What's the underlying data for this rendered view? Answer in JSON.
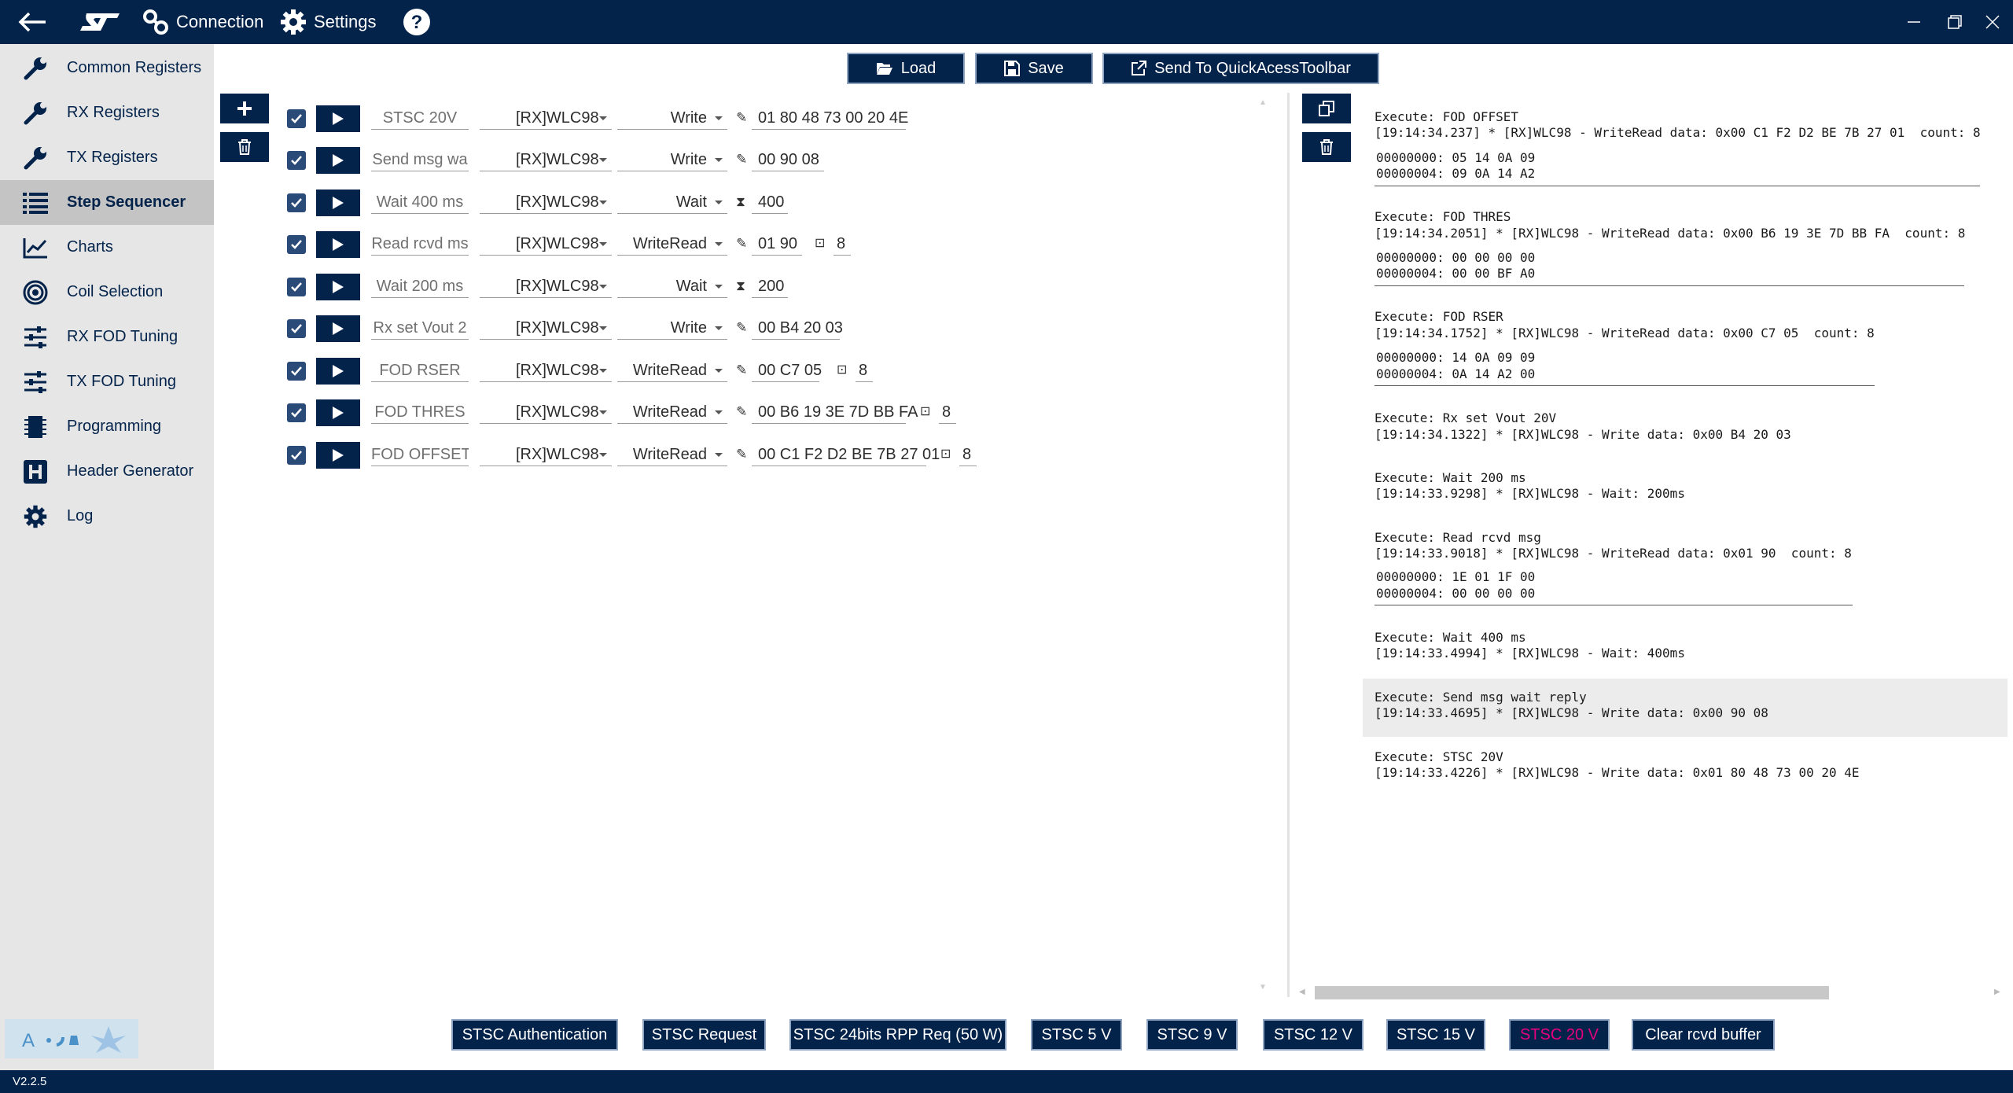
{
  "titlebar": {
    "connection_label": "Connection",
    "settings_label": "Settings",
    "icons": [
      "back-arrow-icon",
      "st-logo",
      "link-icon",
      "gear-icon",
      "help-icon",
      "minimize-icon",
      "restore-icon",
      "close-icon"
    ]
  },
  "sidebar": {
    "items": [
      {
        "label": "Common Registers",
        "icon": "wrench-icon"
      },
      {
        "label": "RX Registers",
        "icon": "wrench-icon"
      },
      {
        "label": "TX Registers",
        "icon": "wrench-icon"
      },
      {
        "label": "Step Sequencer",
        "icon": "list-icon",
        "active": true
      },
      {
        "label": "Charts",
        "icon": "chart-icon"
      },
      {
        "label": "Coil Selection",
        "icon": "coil-icon"
      },
      {
        "label": "RX FOD Tuning",
        "icon": "sliders-icon"
      },
      {
        "label": "TX FOD Tuning",
        "icon": "sliders-icon"
      },
      {
        "label": "Programming",
        "icon": "chip-icon"
      },
      {
        "label": "Header Generator",
        "icon": "header-icon"
      },
      {
        "label": "Log",
        "icon": "gear-icon"
      }
    ]
  },
  "toolbar": {
    "load_label": "Load",
    "save_label": "Save",
    "send_label": "Send To QuickAcessToolbar"
  },
  "sequence": {
    "rows": [
      {
        "name": "STSC 20V",
        "device": "[RX]WLC98",
        "op": "Write",
        "data": "01 80 48 73 00 20 4E",
        "count": ""
      },
      {
        "name": "Send msg wa",
        "device": "[RX]WLC98",
        "op": "Write",
        "data": "00 90 08",
        "count": ""
      },
      {
        "name": "Wait 400 ms",
        "device": "[RX]WLC98",
        "op": "Wait",
        "data": "400",
        "count": ""
      },
      {
        "name": "Read rcvd ms",
        "device": "[RX]WLC98",
        "op": "WriteRead",
        "data": "01 90",
        "count": "8"
      },
      {
        "name": "Wait 200 ms",
        "device": "[RX]WLC98",
        "op": "Wait",
        "data": "200",
        "count": ""
      },
      {
        "name": "Rx set Vout 2",
        "device": "[RX]WLC98",
        "op": "Write",
        "data": "00 B4 20 03",
        "count": ""
      },
      {
        "name": "FOD RSER",
        "device": "[RX]WLC98",
        "op": "WriteRead",
        "data": "00 C7 05",
        "count": "8"
      },
      {
        "name": "FOD THRES",
        "device": "[RX]WLC98",
        "op": "WriteRead",
        "data": "00 B6 19 3E 7D BB FA",
        "count": "8"
      },
      {
        "name": "FOD OFFSET",
        "device": "[RX]WLC98",
        "op": "WriteRead",
        "data": "00 C1 F2 D2 BE 7B 27 01",
        "count": "8"
      }
    ]
  },
  "log": {
    "e1_title": "Execute: FOD OFFSET",
    "e1_line": "[19:14:34.237] * [RX]WLC98 - WriteRead data: 0x00 C1 F2 D2 BE 7B 27 01  count: 8",
    "e1_d1": "00000000: 05 14 0A 09",
    "e1_d2": "00000004: 09 0A 14 A2",
    "e2_title": "Execute: FOD THRES",
    "e2_line": "[19:14:34.2051] * [RX]WLC98 - WriteRead data: 0x00 B6 19 3E 7D BB FA  count: 8",
    "e2_d1": "00000000: 00 00 00 00",
    "e2_d2": "00000004: 00 00 BF A0",
    "e3_title": "Execute: FOD RSER",
    "e3_line": "[19:14:34.1752] * [RX]WLC98 - WriteRead data: 0x00 C7 05  count: 8",
    "e3_d1": "00000000: 14 0A 09 09",
    "e3_d2": "00000004: 0A 14 A2 00",
    "e4_title": "Execute: Rx set Vout 20V",
    "e4_line": "[19:14:34.1322] * [RX]WLC98 - Write data: 0x00 B4 20 03",
    "e5_title": "Execute: Wait 200 ms",
    "e5_line": "[19:14:33.9298] * [RX]WLC98 - Wait: 200ms",
    "e6_title": "Execute: Read rcvd msg",
    "e6_line": "[19:14:33.9018] * [RX]WLC98 - WriteRead data: 0x01 90  count: 8",
    "e6_d1": "00000000: 1E 01 1F 00",
    "e6_d2": "00000004: 00 00 00 00",
    "e7_title": "Execute: Wait 400 ms",
    "e7_line": "[19:14:33.4994] * [RX]WLC98 - Wait: 400ms",
    "e8_title": "Execute: Send msg wait reply",
    "e8_line": "[19:14:33.4695] * [RX]WLC98 - Write data: 0x00 90 08",
    "e9_title": "Execute: STSC 20V",
    "e9_line": "[19:14:33.4226] * [RX]WLC98 - Write data: 0x01 80 48 73 00 20 4E"
  },
  "quick": {
    "b1": "STSC Authentication",
    "b2": "STSC Request",
    "b3": "STSC 24bits RPP Req (50 W)",
    "b4": "STSC 5 V",
    "b5": "STSC 9 V",
    "b6": "STSC 12 V",
    "b7": "STSC 15 V",
    "b8": "STSC 20 V",
    "b9": "Clear rcvd buffer"
  },
  "colors": {
    "navy": "#03234b",
    "highlight": "#e6007e",
    "sidebar_bg": "#e6e6e6",
    "sidebar_active": "#c4c4c4"
  },
  "status": {
    "version": "V2.2.5"
  }
}
